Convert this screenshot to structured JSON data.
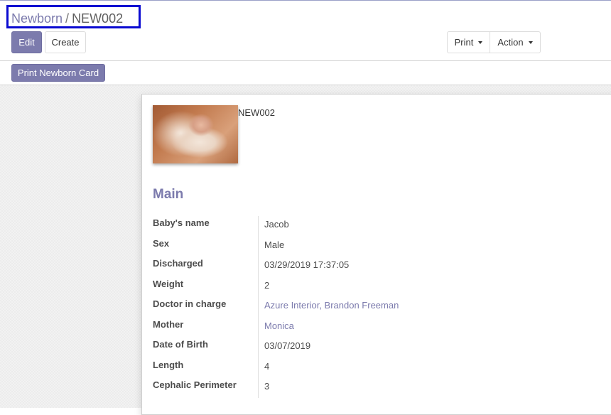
{
  "breadcrumb": {
    "parent": "Newborn",
    "separator": "/",
    "current": "NEW002"
  },
  "toolbar": {
    "edit": "Edit",
    "create": "Create",
    "print": "Print",
    "action": "Action"
  },
  "statusbar": {
    "print_card": "Print Newborn Card"
  },
  "record": {
    "reference": "NEW002",
    "photo_icon": "newborn-photo",
    "section_title": "Main",
    "fields": [
      {
        "label": "Baby's name",
        "value": "Jacob"
      },
      {
        "label": "Sex",
        "value": "Male"
      },
      {
        "label": "Discharged",
        "value": "03/29/2019 17:37:05"
      },
      {
        "label": "Weight",
        "value": "2"
      },
      {
        "label": "Doctor in charge",
        "value": "Azure Interior, Brandon Freeman"
      },
      {
        "label": "Mother",
        "value": "Monica"
      },
      {
        "label": "Date of Birth",
        "value": "03/07/2019"
      },
      {
        "label": "Length",
        "value": "4"
      },
      {
        "label": "Cephalic Perimeter",
        "value": "3"
      }
    ]
  },
  "colors": {
    "brand": "#7c7bad",
    "highlight_box": "#0a0ad1"
  }
}
